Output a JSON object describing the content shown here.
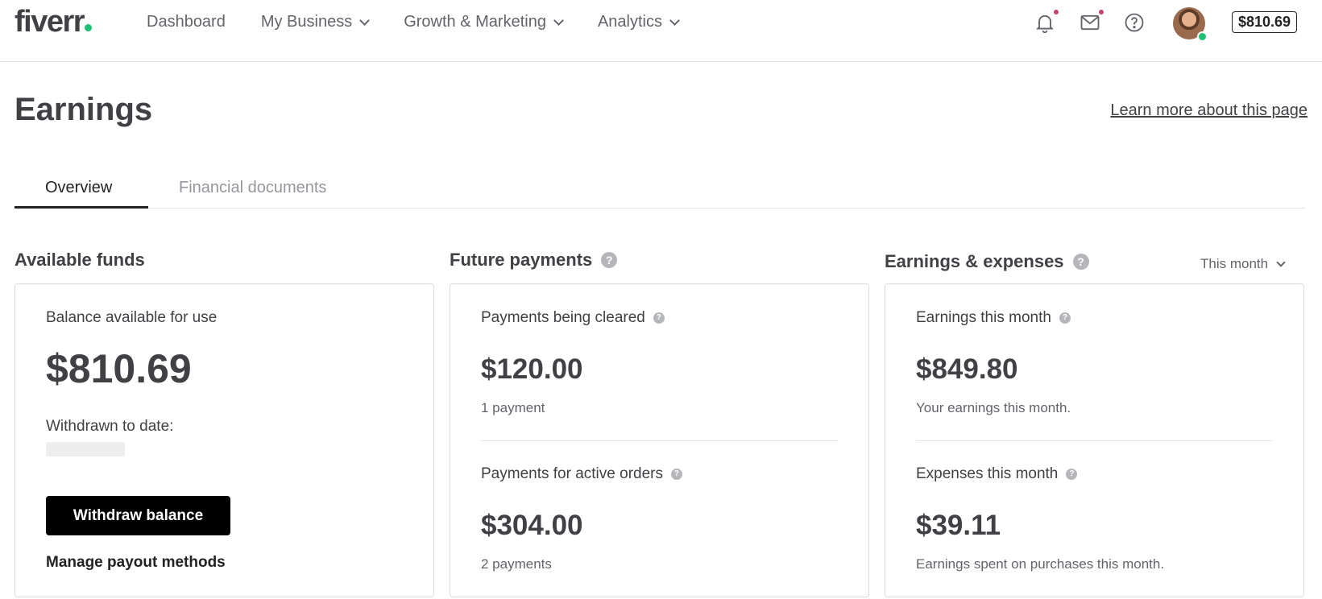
{
  "header": {
    "logo": "fiverr",
    "nav": [
      {
        "label": "Dashboard"
      },
      {
        "label": "My Business"
      },
      {
        "label": "Growth & Marketing"
      },
      {
        "label": "Analytics"
      }
    ],
    "icons": [
      "bell-icon",
      "mail-icon",
      "help-icon"
    ],
    "balance": "$810.69"
  },
  "page": {
    "title": "Earnings",
    "learn_more": "Learn more about this page"
  },
  "tabs": [
    {
      "label": "Overview"
    },
    {
      "label": "Financial documents"
    }
  ],
  "available_funds": {
    "title": "Available funds",
    "balance_label": "Balance available for use",
    "balance": "$810.69",
    "withdrawn_label": "Withdrawn to date:",
    "withdraw_button": "Withdraw balance",
    "manage_link": "Manage payout methods"
  },
  "future_payments": {
    "title": "Future payments",
    "clearing_label": "Payments being cleared",
    "clearing_amount": "$120.00",
    "clearing_count": "1 payment",
    "active_label": "Payments for active orders",
    "active_amount": "$304.00",
    "active_count": "2 payments"
  },
  "earnings_expenses": {
    "title": "Earnings & expenses",
    "period": "This month",
    "earnings_label": "Earnings this month",
    "earnings_amount": "$849.80",
    "earnings_desc": "Your earnings this month.",
    "expenses_label": "Expenses this month",
    "expenses_amount": "$39.11",
    "expenses_desc": "Earnings spent on purchases this month."
  },
  "colors": {
    "brand_green": "#1dbf73",
    "text_dark": "#404145",
    "notification_dot": "#c2426b"
  }
}
